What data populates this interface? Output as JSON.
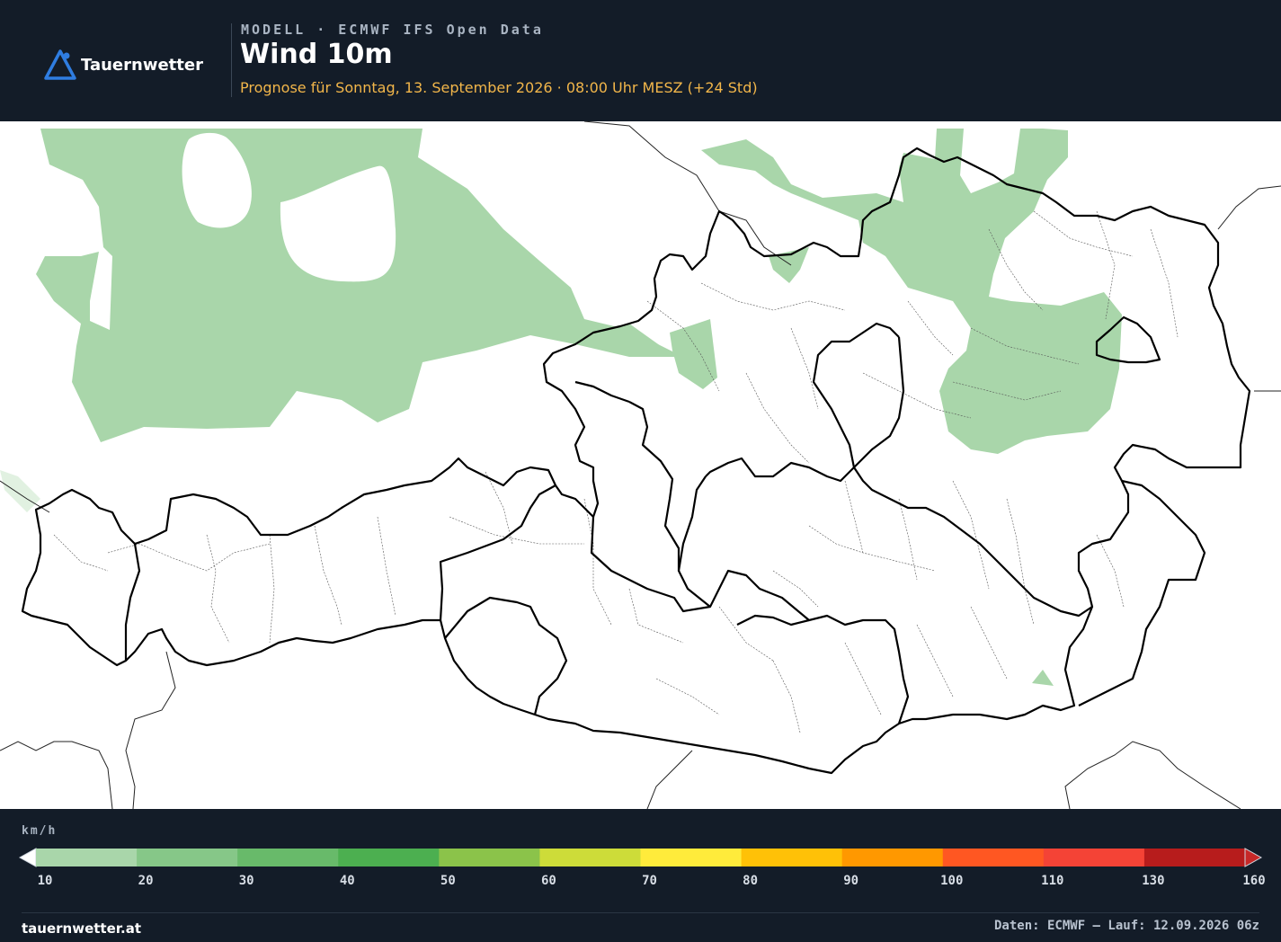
{
  "header": {
    "brand": "Tauernwetter",
    "kicker": "MODELL · ECMWF IFS Open Data",
    "title": "Wind 10m",
    "subtitle": "Prognose für Sonntag, 13. September 2026 · 08:00 Uhr MESZ  (+24 Std)"
  },
  "legend": {
    "unit": "km/h",
    "ticks": [
      "10",
      "20",
      "30",
      "40",
      "50",
      "60",
      "70",
      "80",
      "90",
      "100",
      "110",
      "130",
      "160"
    ],
    "colors": [
      "#a9d6aa",
      "#86c788",
      "#68ba6a",
      "#4caf50",
      "#8bc34a",
      "#cddc39",
      "#ffeb3b",
      "#ffc107",
      "#ff9800",
      "#ff5722",
      "#f44336",
      "#b71c1c"
    ],
    "under_color": "#ffffff",
    "over_color": "#c62828"
  },
  "footer": {
    "site": "tauernwetter.at",
    "credit": "Daten: ECMWF – Lauf: 12.09.2026 06z"
  },
  "map": {
    "region": "Austria",
    "field_color": "#a9d6aa",
    "border_color": "#000000"
  }
}
